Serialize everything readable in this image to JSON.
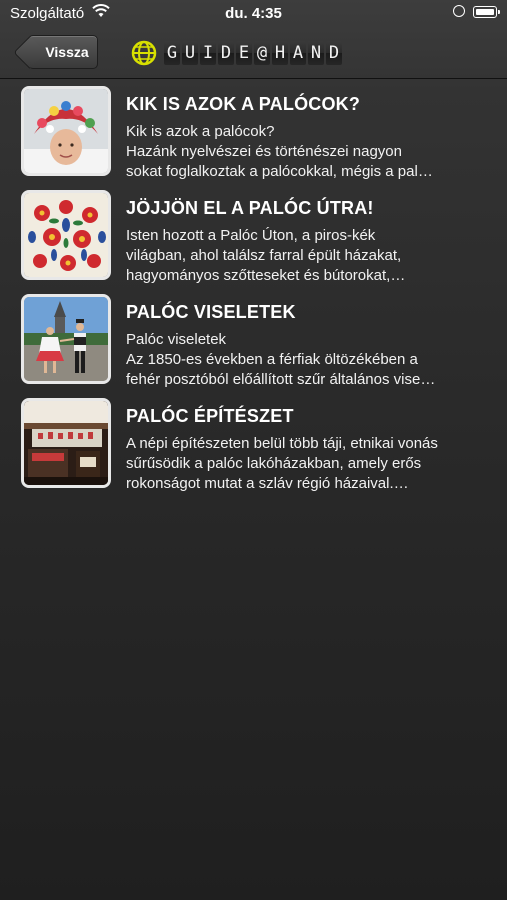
{
  "status_bar": {
    "carrier": "Szolgáltató",
    "time": "du. 4:35"
  },
  "nav": {
    "back_label": "Vissza",
    "logo_letters": [
      "G",
      "U",
      "I",
      "D",
      "E",
      "@",
      "H",
      "A",
      "N",
      "D"
    ]
  },
  "items": [
    {
      "title": "KIK IS AZOK A PALÓCOK?",
      "lines": [
        "Kik is azok a palócok?",
        "Hazánk nyelvészei és történészei nagyon",
        "sokat foglalkoztak a palócokkal, mégis a pal…"
      ],
      "thumb_icon": "girl-in-folk-headdress-photo"
    },
    {
      "title": "JÖJJÖN EL A PALÓC ÚTRA!",
      "lines": [
        "Isten hozott a Palóc Úton, a piros-kék",
        "világban, ahol találsz farral épült házakat,",
        "hagyományos szőtteseket és bútorokat,…"
      ],
      "thumb_icon": "folk-embroidery-photo"
    },
    {
      "title": "PALÓC VISELETEK",
      "lines": [
        "Palóc viseletek",
        "Az 1850-es években a férfiak öltözékében a",
        "fehér posztóból előállított szűr általános vise…"
      ],
      "thumb_icon": "dancers-in-costume-photo"
    },
    {
      "title": "PALÓC ÉPÍTÉSZET",
      "lines": [
        "A népi építészeten belül több táji, etnikai vonás",
        "sűrűsödik a palóc lakóházakban, amely erős",
        "rokonságot mutat a szláv régió házaival.…"
      ],
      "thumb_icon": "house-interior-photo"
    }
  ]
}
